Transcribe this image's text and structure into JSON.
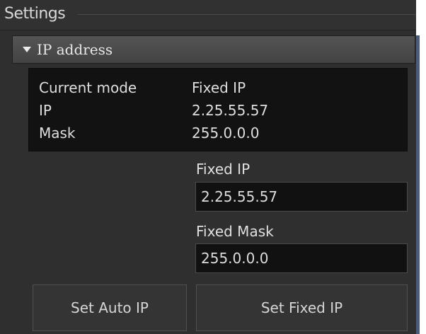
{
  "settings": {
    "title": "Settings"
  },
  "ip_section": {
    "title": "IP address",
    "icon": "triangle-down-icon"
  },
  "status": {
    "rows": [
      {
        "label": "Current mode",
        "value": "Fixed IP"
      },
      {
        "label": "IP",
        "value": "2.25.55.57"
      },
      {
        "label": "Mask",
        "value": "255.0.0.0"
      }
    ]
  },
  "fixed_ip": {
    "label": "Fixed IP",
    "value": "2.25.55.57"
  },
  "fixed_mask": {
    "label": "Fixed Mask",
    "value": "255.0.0.0"
  },
  "buttons": {
    "set_auto": "Set Auto IP",
    "set_fixed": "Set Fixed IP"
  },
  "colors": {
    "panel_background": "#2f2f2f",
    "info_box_background": "#121212",
    "text": "#dedede",
    "right_rule": "#4b5b78"
  }
}
